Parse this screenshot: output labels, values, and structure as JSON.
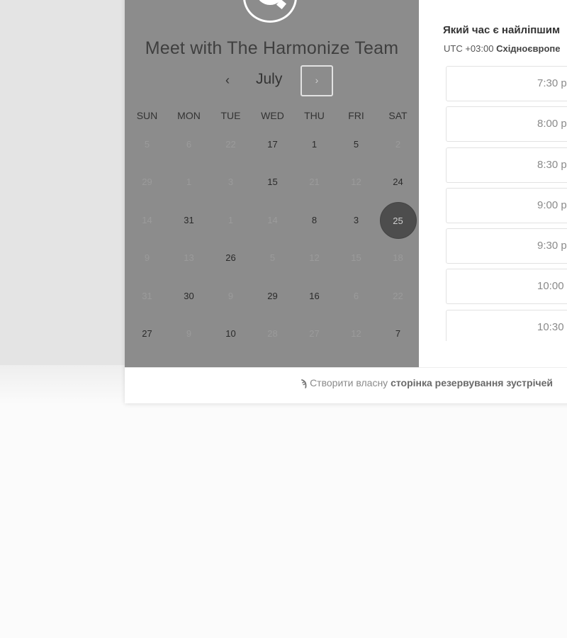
{
  "team": {
    "title": "Meet with The Harmonize Team",
    "avatar_icon": "chat-bubble-icon"
  },
  "calendar": {
    "month": "July",
    "prev_icon": "‹",
    "next_icon": "›",
    "weekdays": [
      "SUN",
      "MON",
      "TUE",
      "WED",
      "THU",
      "FRI",
      "SAT"
    ],
    "weeks": [
      [
        {
          "d": "5",
          "a": false
        },
        {
          "d": "6",
          "a": false
        },
        {
          "d": "22",
          "a": false
        },
        {
          "d": "17",
          "a": true
        },
        {
          "d": "1",
          "a": true
        },
        {
          "d": "5",
          "a": true
        },
        {
          "d": "2",
          "a": false
        }
      ],
      [
        {
          "d": "29",
          "a": false
        },
        {
          "d": "1",
          "a": false
        },
        {
          "d": "3",
          "a": false
        },
        {
          "d": "15",
          "a": true
        },
        {
          "d": "21",
          "a": false
        },
        {
          "d": "12",
          "a": false
        },
        {
          "d": "24",
          "a": true
        }
      ],
      [
        {
          "d": "14",
          "a": false
        },
        {
          "d": "31",
          "a": true
        },
        {
          "d": "1",
          "a": false
        },
        {
          "d": "14",
          "a": false
        },
        {
          "d": "8",
          "a": true
        },
        {
          "d": "3",
          "a": true
        },
        {
          "d": "25",
          "a": true,
          "selected": true
        }
      ],
      [
        {
          "d": "9",
          "a": false
        },
        {
          "d": "13",
          "a": false
        },
        {
          "d": "26",
          "a": true
        },
        {
          "d": "5",
          "a": false
        },
        {
          "d": "12",
          "a": false
        },
        {
          "d": "15",
          "a": false
        },
        {
          "d": "18",
          "a": false
        }
      ],
      [
        {
          "d": "31",
          "a": false
        },
        {
          "d": "30",
          "a": true
        },
        {
          "d": "9",
          "a": false
        },
        {
          "d": "29",
          "a": true
        },
        {
          "d": "16",
          "a": true
        },
        {
          "d": "6",
          "a": false
        },
        {
          "d": "22",
          "a": false
        }
      ],
      [
        {
          "d": "27",
          "a": true
        },
        {
          "d": "9",
          "a": false
        },
        {
          "d": "10",
          "a": true
        },
        {
          "d": "28",
          "a": false
        },
        {
          "d": "27",
          "a": false
        },
        {
          "d": "12",
          "a": false
        },
        {
          "d": "7",
          "a": true
        }
      ]
    ]
  },
  "time_picker": {
    "question": "Який час є найліпшим",
    "tz_prefix": "UTC +03:00",
    "tz_name": "Східноєвропе",
    "slots": [
      "7:30 p",
      "8:00 p",
      "8:30 p",
      "9:00 p",
      "9:30 p",
      "10:00",
      "10:30"
    ]
  },
  "footer": {
    "prefix": "Створити власну",
    "bold": "сторінка резервування зустрічей",
    "icon": "hubspot-sprocket-icon"
  }
}
